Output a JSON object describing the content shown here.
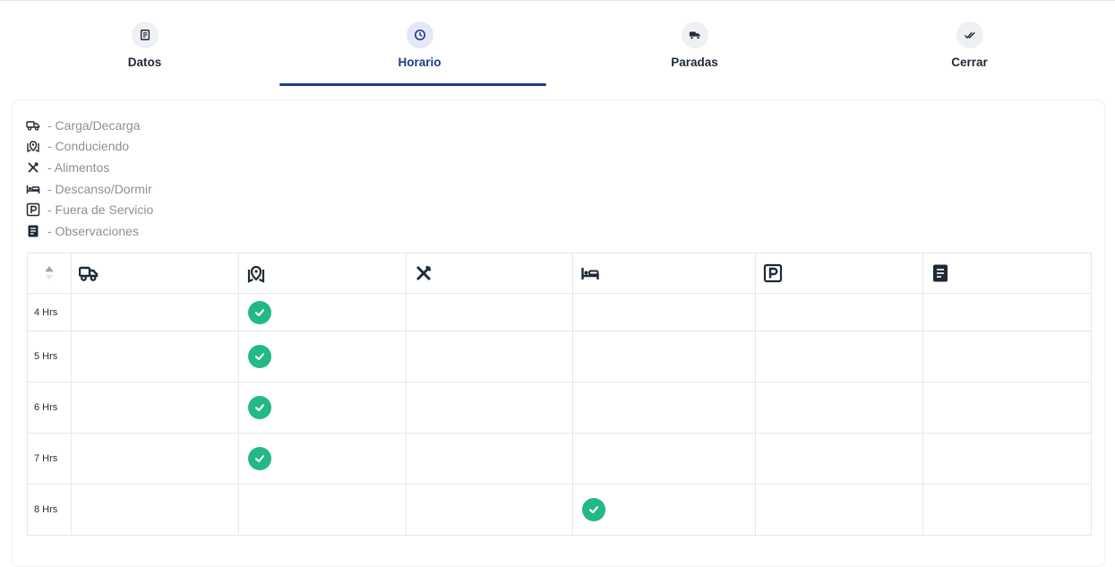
{
  "stepper": {
    "steps": [
      {
        "label": "Datos",
        "icon": "document-icon"
      },
      {
        "label": "Horario",
        "icon": "clock-icon",
        "active": true
      },
      {
        "label": "Paradas",
        "icon": "truck-icon"
      },
      {
        "label": "Cerrar",
        "icon": "double-check-icon"
      }
    ]
  },
  "legend": {
    "items": [
      {
        "label": "- Carga/Decarga",
        "icon": "truck-icon"
      },
      {
        "label": "- Conduciendo",
        "icon": "map-pin-icon"
      },
      {
        "label": "- Alimentos",
        "icon": "utensils-icon"
      },
      {
        "label": "- Descanso/Dormir",
        "icon": "bed-icon"
      },
      {
        "label": "- Fuera de Servicio",
        "icon": "parking-icon"
      },
      {
        "label": "- Observaciones",
        "icon": "notes-icon"
      }
    ]
  },
  "table": {
    "columns": [
      "truck-icon",
      "map-pin-icon",
      "utensils-icon",
      "bed-icon",
      "parking-icon",
      "notes-icon"
    ],
    "rows": [
      {
        "hours": "4 Hrs",
        "checks": [
          false,
          true,
          false,
          false,
          false,
          false
        ]
      },
      {
        "hours": "5 Hrs",
        "checks": [
          false,
          true,
          false,
          false,
          false,
          false
        ]
      },
      {
        "hours": "6 Hrs",
        "checks": [
          false,
          true,
          false,
          false,
          false,
          false
        ]
      },
      {
        "hours": "7 Hrs",
        "checks": [
          false,
          true,
          false,
          false,
          false,
          false
        ]
      },
      {
        "hours": "8 Hrs",
        "checks": [
          false,
          false,
          false,
          true,
          false,
          false
        ]
      }
    ]
  },
  "colors": {
    "accent": "#1e3a8a",
    "check": "#22b887"
  }
}
